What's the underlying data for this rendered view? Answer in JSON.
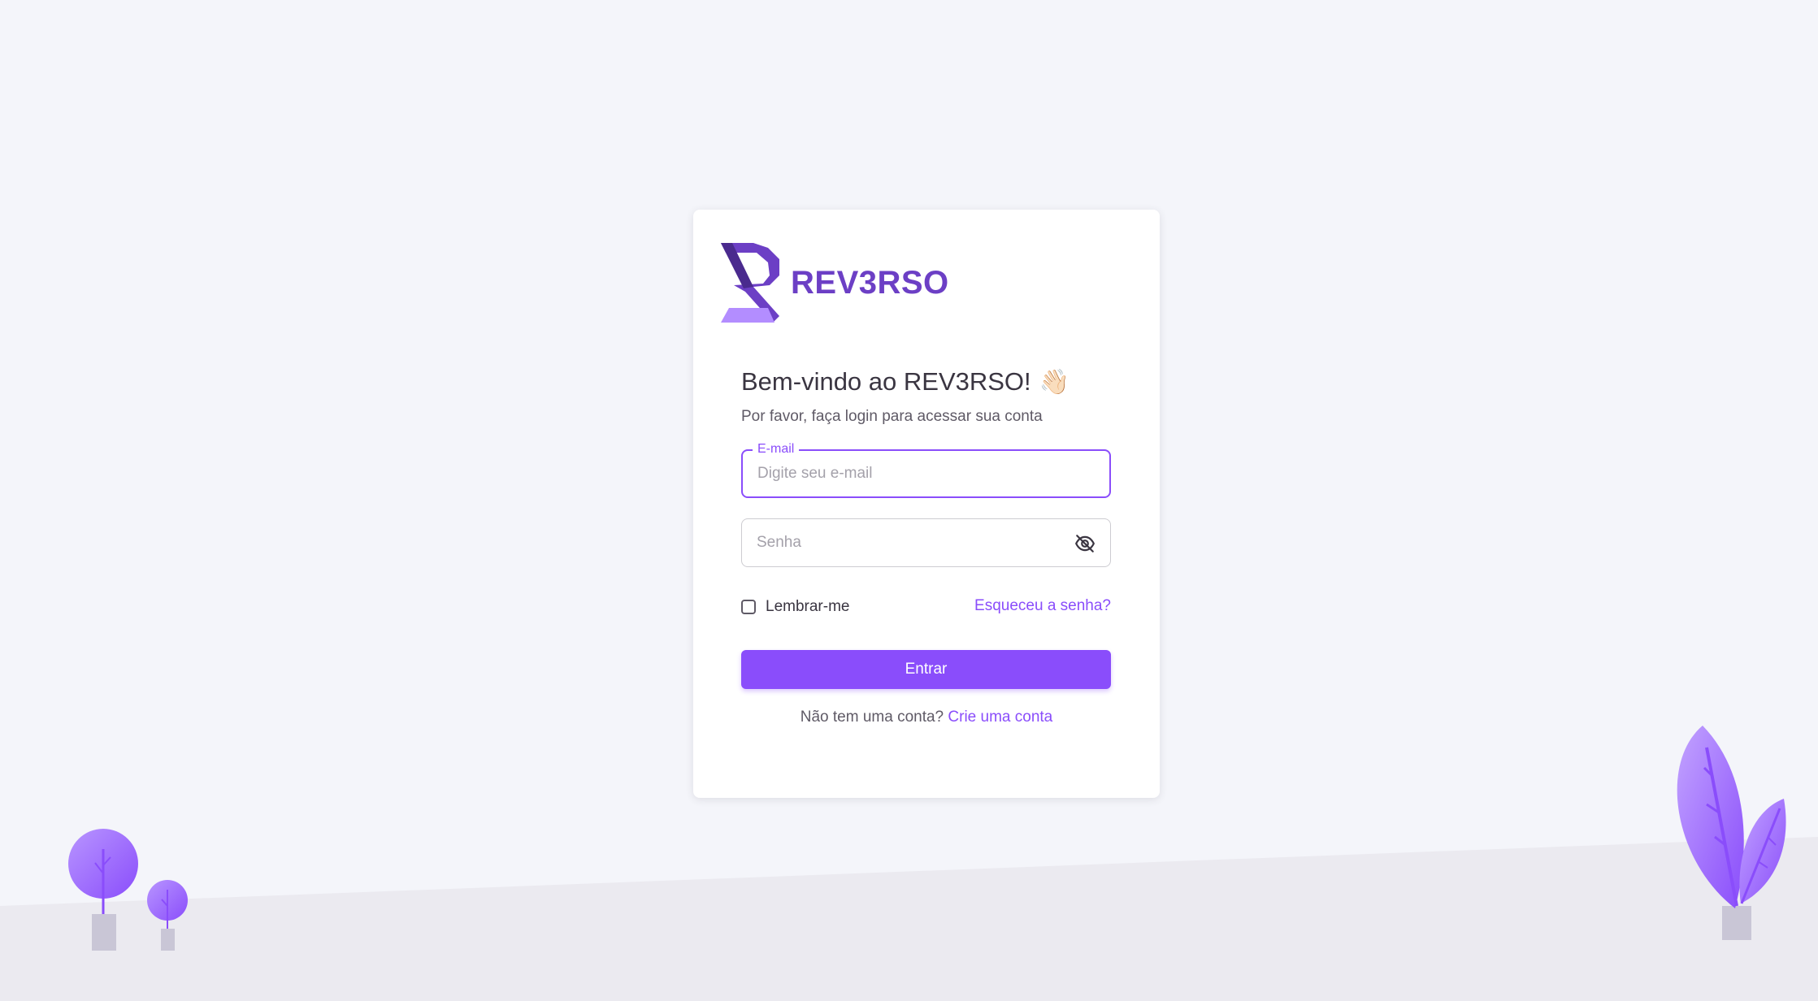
{
  "brand": {
    "name": "REV3RSO",
    "logo_icon": "r3-logo-icon",
    "accent_color": "#8a4dfb",
    "logo_color": "#6c3fc5"
  },
  "login": {
    "title": "Bem-vindo ao REV3RSO!",
    "wave_emoji": "👋🏻",
    "subtitle": "Por favor, faça login para acessar sua conta",
    "email": {
      "label": "E-mail",
      "placeholder": "Digite seu e-mail",
      "value": ""
    },
    "password": {
      "placeholder": "Senha",
      "value": "",
      "visibility_icon": "eye-off-icon"
    },
    "remember_me": {
      "label": "Lembrar-me",
      "checked": false
    },
    "forgot_link": "Esqueceu a senha?",
    "submit_label": "Entrar",
    "signup_prompt": "Não tem uma conta?",
    "signup_link": "Crie uma conta"
  },
  "background": {
    "color": "#f4f5fa",
    "ground_color": "#ebeaf0",
    "decorations": [
      "tree-illustration",
      "small-tree-illustration",
      "leaf-plant-illustration"
    ]
  }
}
